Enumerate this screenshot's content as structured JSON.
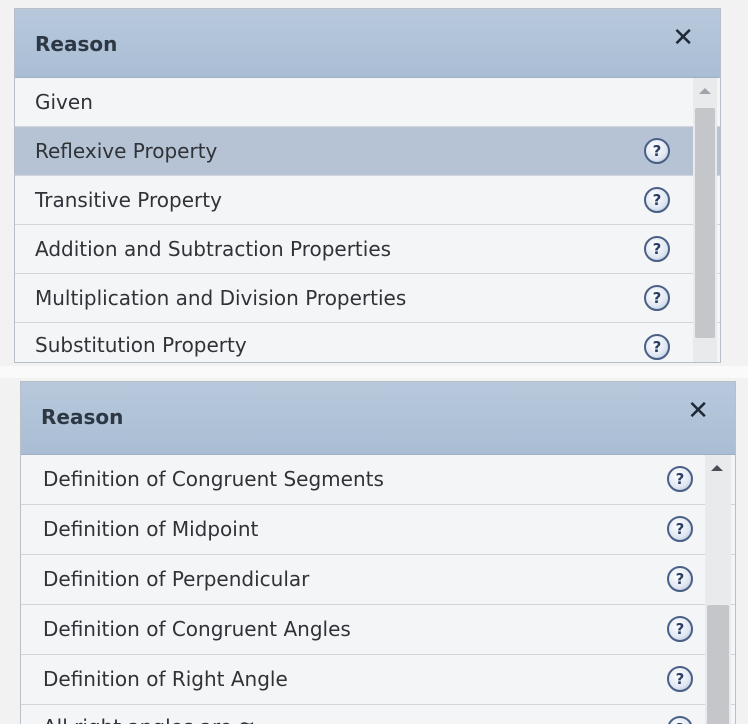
{
  "top_panel": {
    "title": "Reason",
    "close": "✕",
    "help_glyph": "?",
    "items": [
      {
        "label": "Given",
        "has_help": false,
        "selected": false
      },
      {
        "label": "Reflexive Property",
        "has_help": true,
        "selected": true
      },
      {
        "label": "Transitive Property",
        "has_help": true,
        "selected": false
      },
      {
        "label": "Addition and Subtraction Properties",
        "has_help": true,
        "selected": false
      },
      {
        "label": "Multiplication and Division Properties",
        "has_help": true,
        "selected": false
      },
      {
        "label": "Substitution Property",
        "has_help": true,
        "selected": false
      }
    ]
  },
  "bottom_panel": {
    "title": "Reason",
    "close": "✕",
    "help_glyph": "?",
    "items": [
      {
        "label": "Definition of Congruent Segments",
        "has_help": true
      },
      {
        "label": "Definition of Midpoint",
        "has_help": true
      },
      {
        "label": "Definition of Perpendicular",
        "has_help": true
      },
      {
        "label": "Definition of Congruent Angles",
        "has_help": true
      },
      {
        "label": "Definition of Right Angle",
        "has_help": true
      },
      {
        "label": "All right angles are ≅",
        "has_help": true
      }
    ]
  },
  "colors": {
    "header": "#aec1d7",
    "selected_row": "#b5c3d4",
    "help_ring": "#4a5f86"
  },
  "icons": {
    "close": "close-icon",
    "help": "help-icon",
    "scroll_up": "scroll-up-arrow-icon"
  }
}
